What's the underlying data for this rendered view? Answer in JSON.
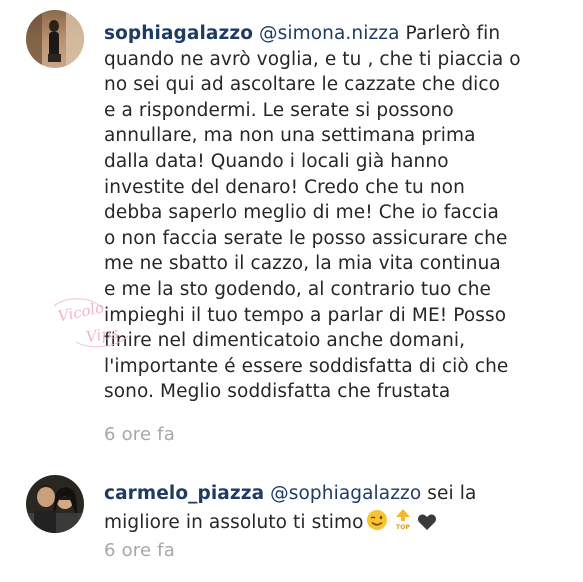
{
  "comments": [
    {
      "username": "sophiagalazzo",
      "mention": "@simona.nizza",
      "lines": [
        "Parlerò fin",
        "quando ne avrò voglia, e tu , che ti piaccia o",
        "no sei qui ad ascoltare le cazzate che dico",
        "e a rispondermi. Le serate si possono",
        "annullare, ma non una settimana prima",
        "dalla data! Quando i locali già hanno",
        "investite del denaro! Credo che tu non",
        "debba saperlo meglio di me! Che io faccia",
        "o non faccia serate le posso assicurare che",
        "me ne sbatto il cazzo, la mia vita continua",
        "e me la sto godendo, al contrario tuo che",
        "impieghi il tuo tempo a parlar di ME! Posso",
        "finire nel dimenticatoio anche domani,",
        "l'importante é essere soddisfatta di ciò che",
        "sono. Meglio soddisfatta che frustata"
      ],
      "time": "6 ore fa"
    },
    {
      "username": "carmelo_piazza",
      "mention": "@sophiagalazzo",
      "lines": [
        "sei la",
        "migliore in assoluto ti stimo"
      ],
      "emoji_top_label": "TOP",
      "time": "6 ore fa"
    }
  ],
  "watermark": {
    "line1": "Vicolo",
    "line2": "Vips"
  },
  "colors": {
    "username": "#1f3b63",
    "text": "#262626",
    "time": "#a7a7a7",
    "heart": "#3a3a3a",
    "wink_emoji": "#f7c531",
    "top_arrow": "#f5b82a"
  },
  "icons": [
    "avatar-sophiagalazzo",
    "avatar-carmelo-piazza",
    "wink-emoji",
    "top-arrow-icon",
    "black-heart-icon"
  ]
}
